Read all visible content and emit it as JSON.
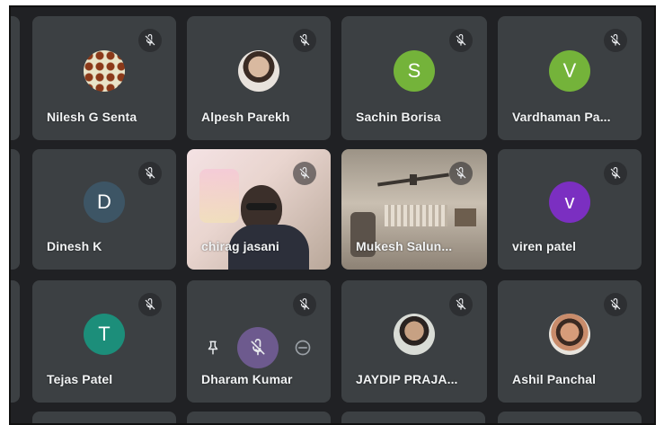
{
  "colors": {
    "background": "#202124",
    "tile": "#3c4043",
    "avatar_green": "#74b33a",
    "avatar_teal": "#3d5565",
    "avatar_purple": "#7b2fc1",
    "avatar_tealgreen": "#1c8e7a",
    "avatar_muted_purple": "#6d5a8e"
  },
  "participants": [
    {
      "name": "Nilesh G Senta",
      "avatar_type": "photo",
      "muted": true
    },
    {
      "name": "Alpesh Parekh",
      "avatar_type": "photo",
      "muted": true
    },
    {
      "name": "Sachin Borisa",
      "avatar_letter": "S",
      "avatar_type": "letter",
      "muted": true
    },
    {
      "name": "Vardhaman Pa...",
      "avatar_letter": "V",
      "avatar_type": "letter",
      "muted": true
    },
    {
      "name": "Dinesh K",
      "avatar_letter": "D",
      "avatar_type": "letter",
      "muted": true
    },
    {
      "name": "chirag jasani",
      "avatar_type": "video",
      "muted": true
    },
    {
      "name": "Mukesh Salun...",
      "avatar_type": "video",
      "muted": true
    },
    {
      "name": "viren patel",
      "avatar_letter": "v",
      "avatar_type": "letter",
      "muted": true
    },
    {
      "name": "Tejas Patel",
      "avatar_letter": "T",
      "avatar_type": "letter",
      "muted": true
    },
    {
      "name": "Dharam Kumar",
      "avatar_type": "hover_controls",
      "muted": true
    },
    {
      "name": "JAYDIP PRAJA...",
      "avatar_type": "photo",
      "muted": true
    },
    {
      "name": "Ashil Panchal",
      "avatar_type": "photo",
      "muted": true
    }
  ],
  "icons": {
    "mute": "mic-off-icon",
    "pin": "pin-icon",
    "mute_others": "mic-off-circle-icon",
    "remove": "remove-circle-icon"
  }
}
